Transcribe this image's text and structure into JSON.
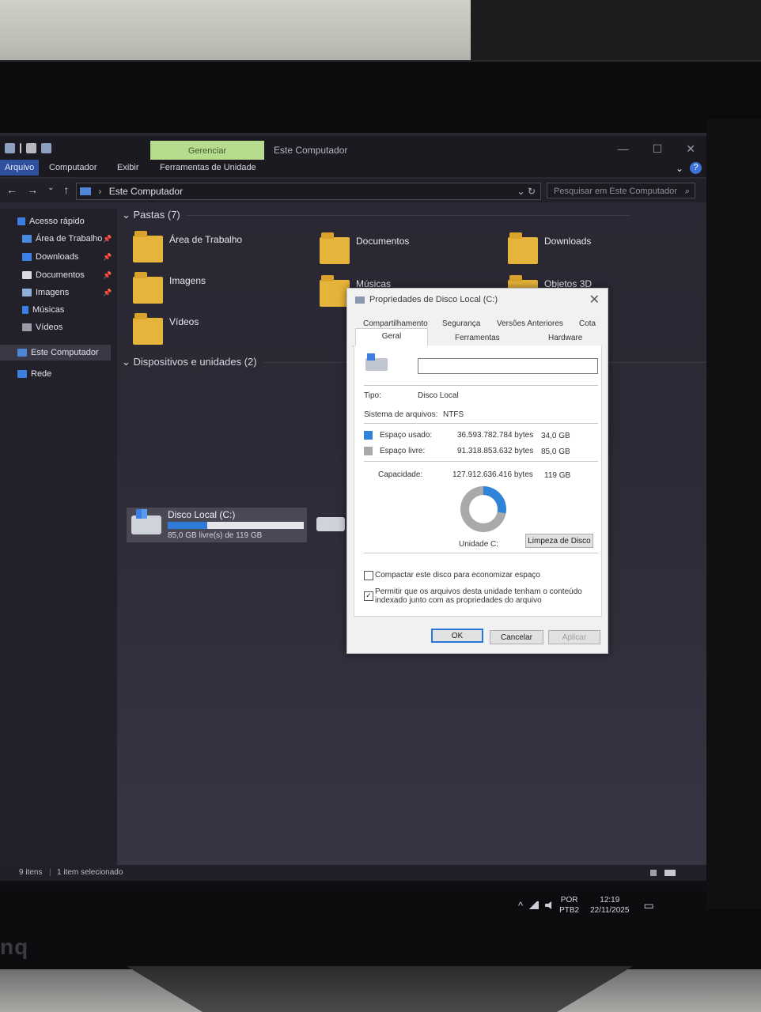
{
  "monitor": {
    "brand": "nq"
  },
  "titlebar": {
    "manage_tab": "Gerenciar",
    "title": "Este Computador",
    "minimize": "—",
    "maximize": "☐",
    "close": "✕"
  },
  "ribbon": {
    "tabs": [
      "Arquivo",
      "Computador",
      "Exibir",
      "Ferramentas de Unidade"
    ],
    "expand": "⌄",
    "help": "?"
  },
  "address": {
    "back": "←",
    "forward": "→",
    "recent": "⌄",
    "up": "↑",
    "path": "Este Computador",
    "path_sep": "›",
    "dropdown": "⌄",
    "refresh": "↻",
    "search_placeholder": "Pesquisar em Este Computador",
    "search_icon": "⌕"
  },
  "sidebar": {
    "items": [
      {
        "label": "Acesso rápido",
        "icon": "star-icon"
      },
      {
        "label": "Área de Trabalho",
        "icon": "desktop-icon",
        "pinned": true
      },
      {
        "label": "Downloads",
        "icon": "download-icon",
        "pinned": true
      },
      {
        "label": "Documentos",
        "icon": "document-icon",
        "pinned": true
      },
      {
        "label": "Imagens",
        "icon": "image-icon",
        "pinned": true
      },
      {
        "label": "Músicas",
        "icon": "music-icon"
      },
      {
        "label": "Vídeos",
        "icon": "video-icon"
      },
      {
        "label": "Este Computador",
        "icon": "computer-icon",
        "selected": true
      },
      {
        "label": "Rede",
        "icon": "network-icon"
      }
    ],
    "pin_glyph": "📌"
  },
  "content": {
    "folders_header": "Pastas (7)",
    "folders": [
      "Área de Trabalho",
      "Documentos",
      "Downloads",
      "Imagens",
      "Músicas",
      "Objetos 3D",
      "Vídeos"
    ],
    "devices_header": "Dispositivos e unidades (2)",
    "drive": {
      "name": "Disco Local (C:)",
      "free_text": "85,0 GB livre(s) de 119 GB",
      "used_fraction": 0.29
    }
  },
  "statusbar": {
    "items": "9 itens",
    "selected": "1 item selecionado"
  },
  "tray": {
    "lang1": "POR",
    "lang2": "PTB2",
    "time": "12:19",
    "date": "22/11/2025",
    "chevron": "^",
    "notification": "▭"
  },
  "dialog": {
    "title": "Propriedades de Disco Local (C:)",
    "close": "✕",
    "tabs_top": [
      "Compartilhamento",
      "Segurança",
      "Versões Anteriores",
      "Cota"
    ],
    "tabs_bottom": [
      "Geral",
      "Ferramentas",
      "Hardware"
    ],
    "name_value": "",
    "tipo_label": "Tipo:",
    "tipo_value": "Disco Local",
    "fs_label": "Sistema de arquivos:",
    "fs_value": "NTFS",
    "used_label": "Espaço usado:",
    "used_bytes": "36.593.782.784 bytes",
    "used_gb": "34,0 GB",
    "free_label": "Espaço livre:",
    "free_bytes": "91.318.853.632 bytes",
    "free_gb": "85,0 GB",
    "cap_label": "Capacidade:",
    "cap_bytes": "127.912.636.416 bytes",
    "cap_gb": "119 GB",
    "used_color": "#2f83d9",
    "free_color": "#a9a9a9",
    "used_fraction": 0.28,
    "drive_label": "Unidade C:",
    "cleanup": "Limpeza de Disco",
    "compress": "Compactar este disco para economizar espaço",
    "index": "Permitir que os arquivos desta unidade tenham o conteúdo indexado junto com as propriedades do arquivo",
    "compress_checked": false,
    "index_checked": true,
    "ok": "OK",
    "cancel": "Cancelar",
    "apply": "Aplicar"
  }
}
